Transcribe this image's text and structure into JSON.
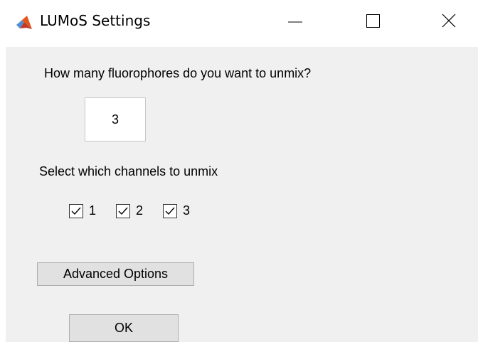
{
  "window": {
    "title": "LUMoS Settings",
    "icon": "matlab-icon",
    "controls": {
      "minimize": "minimize-icon",
      "maximize": "maximize-icon",
      "close": "close-icon"
    }
  },
  "form": {
    "question": "How many fluorophores do you want to unmix?",
    "fluorophore_count": "3",
    "channels_label": "Select which channels to unmix",
    "channels": [
      {
        "label": "1",
        "checked": true
      },
      {
        "label": "2",
        "checked": true
      },
      {
        "label": "3",
        "checked": true
      }
    ],
    "advanced_label": "Advanced Options",
    "ok_label": "OK"
  },
  "colors": {
    "panel_background": "#f0f0f0",
    "button_background": "#e1e1e1",
    "title_background": "#ffffff"
  }
}
